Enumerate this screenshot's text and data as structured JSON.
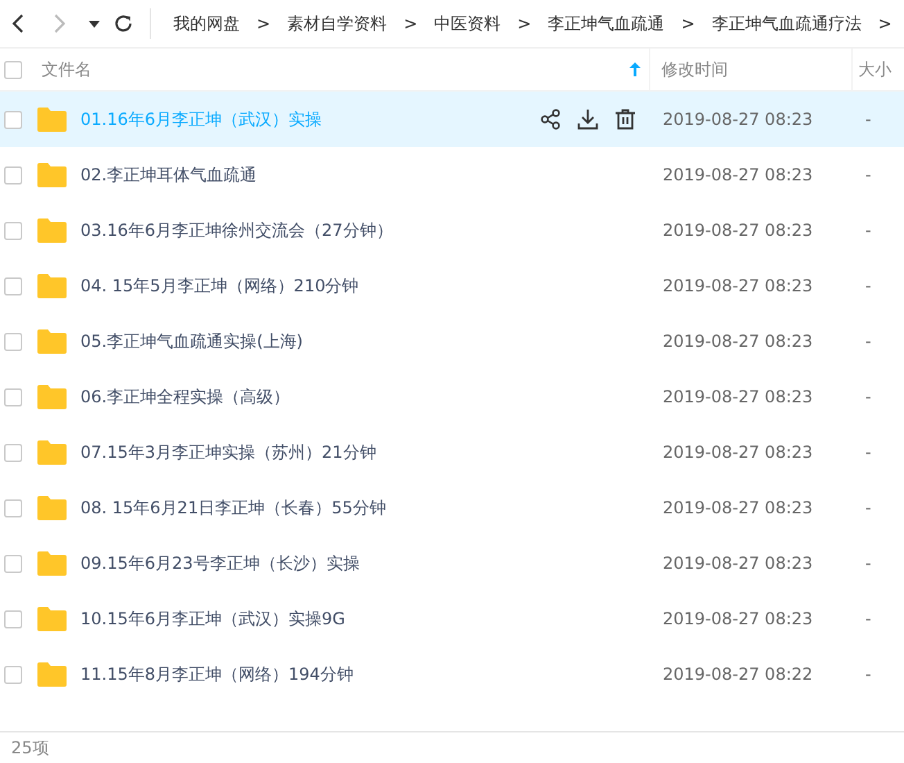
{
  "nav": {
    "breadcrumbs": [
      "我的网盘",
      "素材自学资料",
      "中医资料",
      "李正坤气血疏通",
      "李正坤气血疏通疗法"
    ],
    "separator": ">"
  },
  "table": {
    "columns": [
      {
        "label": "文件名",
        "sorted": true
      },
      {
        "label": "修改时间",
        "sorted": false
      },
      {
        "label": "大小",
        "sorted": false
      }
    ],
    "all_checked": false,
    "rows": [
      {
        "name": "01.16年6月李正坤（武汉）实操",
        "modified": "2019-08-27 08:23",
        "size": "-",
        "selected": true,
        "checked": false
      },
      {
        "name": "02.李正坤耳体气血疏通",
        "modified": "2019-08-27 08:23",
        "size": "-",
        "selected": false,
        "checked": false
      },
      {
        "name": "03.16年6月李正坤徐州交流会（27分钟）",
        "modified": "2019-08-27 08:23",
        "size": "-",
        "selected": false,
        "checked": false
      },
      {
        "name": "04. 15年5月李正坤（网络）210分钟",
        "modified": "2019-08-27 08:23",
        "size": "-",
        "selected": false,
        "checked": false
      },
      {
        "name": "05.李正坤气血疏通实操(上海)",
        "modified": "2019-08-27 08:23",
        "size": "-",
        "selected": false,
        "checked": false
      },
      {
        "name": "06.李正坤全程实操（高级）",
        "modified": "2019-08-27 08:23",
        "size": "-",
        "selected": false,
        "checked": false
      },
      {
        "name": "07.15年3月李正坤实操（苏州）21分钟",
        "modified": "2019-08-27 08:23",
        "size": "-",
        "selected": false,
        "checked": false
      },
      {
        "name": "08. 15年6月21日李正坤（长春）55分钟",
        "modified": "2019-08-27 08:23",
        "size": "-",
        "selected": false,
        "checked": false
      },
      {
        "name": "09.15年6月23号李正坤（长沙）实操",
        "modified": "2019-08-27 08:23",
        "size": "-",
        "selected": false,
        "checked": false
      },
      {
        "name": "10.15年6月李正坤（武汉）实操9G",
        "modified": "2019-08-27 08:23",
        "size": "-",
        "selected": false,
        "checked": false
      },
      {
        "name": "11.15年8月李正坤（网络）194分钟",
        "modified": "2019-08-27 08:22",
        "size": "-",
        "selected": false,
        "checked": false
      }
    ]
  },
  "status_bar": {
    "count": "25项"
  }
}
